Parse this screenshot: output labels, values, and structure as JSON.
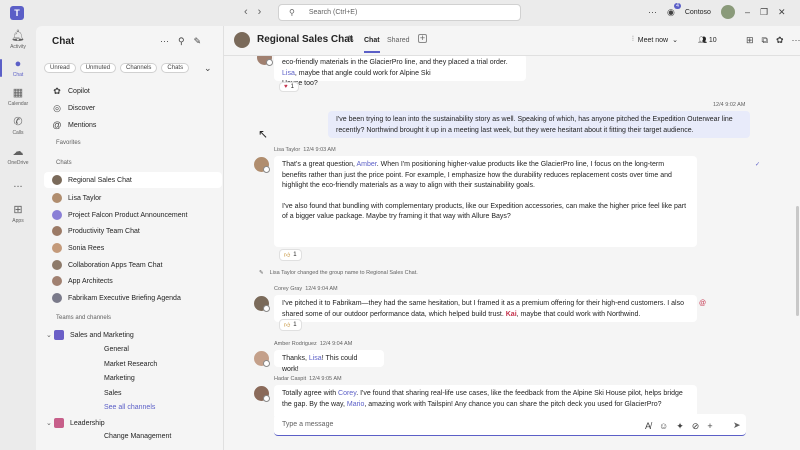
{
  "titlebar": {
    "search_placeholder": "Search (Ctrl+E)",
    "org": "Contoso",
    "notif_count": "4"
  },
  "rail": {
    "items": [
      {
        "label": "Activity",
        "icon": "bell-icon"
      },
      {
        "label": "Chat",
        "icon": "chat-icon"
      },
      {
        "label": "Calendar",
        "icon": "calendar-icon"
      },
      {
        "label": "Calls",
        "icon": "phone-icon"
      },
      {
        "label": "OneDrive",
        "icon": "cloud-icon"
      },
      {
        "label": "...",
        "icon": "more-icon"
      },
      {
        "label": "Apps",
        "icon": "apps-icon"
      }
    ]
  },
  "leftpane": {
    "title": "Chat",
    "filters": [
      "Unread",
      "Unmuted",
      "Channels",
      "Chats"
    ],
    "shortcuts": [
      "Copilot",
      "Discover",
      "Mentions"
    ],
    "favorites_label": "Favorites",
    "chats_label": "Chats",
    "chats": [
      "Regional Sales Chat",
      "Lisa Taylor",
      "Project Falcon Product Announcement",
      "Productivity Team Chat",
      "Sonia Rees",
      "Collaboration Apps Team Chat",
      "App Architects",
      "Fabrikam Executive Briefing Agenda"
    ],
    "teams_label": "Teams and channels",
    "teams": [
      {
        "name": "Sales and Marketing",
        "channels": [
          "General",
          "Market Research",
          "Marketing",
          "Sales"
        ],
        "see_all": "See all channels"
      },
      {
        "name": "Leadership",
        "channels": [
          "Change Management"
        ]
      }
    ]
  },
  "header": {
    "title": "Regional Sales Chat",
    "tab_chat": "Chat",
    "tab_shared": "Shared",
    "meet": "Meet now",
    "people_count": "10"
  },
  "messages": {
    "m0_text": "eco-friendly materials in the GlacierPro line, and they placed a trial order. ",
    "m0_mention": "Lisa",
    "m0_tail": ", maybe that angle could work for Alpine Ski",
    "m0_line2": "House too?",
    "m0_reaction": "1",
    "m1_time": "12/4 9:02 AM",
    "m1_text": "I've been trying to lean into the sustainability story as well. Speaking of which, has anyone pitched the Expedition Outerwear line recently? Northwind brought it up in a meeting last week, but they were hesitant about it fitting their target audience.",
    "m2_sender": "Lisa Taylor",
    "m2_time": "12/4 9:03 AM",
    "m2_p1a": "That's a great question, ",
    "m2_mention": "Amber",
    "m2_p1b": ". When I'm positioning higher-value products like the GlacierPro line, I focus on the long-term benefits rather than just the price point. For example, I emphasize how the durability reduces replacement costs over time and highlight the eco-friendly materials as a way to align with their sustainability goals.",
    "m2_p2": "I've also found that bundling with complementary products, like our Expedition accessories, can make the higher price feel like part of a bigger value package. Maybe try framing it that way with Allure Bays?",
    "m2_reaction": "1",
    "sys": "Lisa Taylor changed the group name to Regional Sales Chat.",
    "m3_sender": "Corey Gray",
    "m3_time": "12/4 9:04 AM",
    "m3_a": "I've pitched it to Fabrikam—they had the same hesitation, but I framed it as a premium offering for their high-end customers. I also shared some of our outdoor performance data, which helped build trust. ",
    "m3_mention": "Kai",
    "m3_b": ", maybe that could work with Northwind.",
    "m3_reaction": "1",
    "m4_sender": "Amber Rodriguez",
    "m4_time": "12/4 9:04 AM",
    "m4_a": "Thanks, ",
    "m4_mention": "Lisa",
    "m4_b": "! This could work!",
    "m5_sender": "Hadar Caspit",
    "m5_time": "12/4 9:05 AM",
    "m5_a": "Totally agree with ",
    "m5_mention1": "Corey",
    "m5_b": ". I've found that sharing real-life use cases, like the feedback from the Alpine Ski House pilot, helps bridge the gap. By the way, ",
    "m5_mention2": "Mario",
    "m5_c": ", amazing work with Tailspin! Any chance you can share the pitch deck you used for GlacierPro?"
  },
  "composer": {
    "placeholder": "Type a message"
  }
}
